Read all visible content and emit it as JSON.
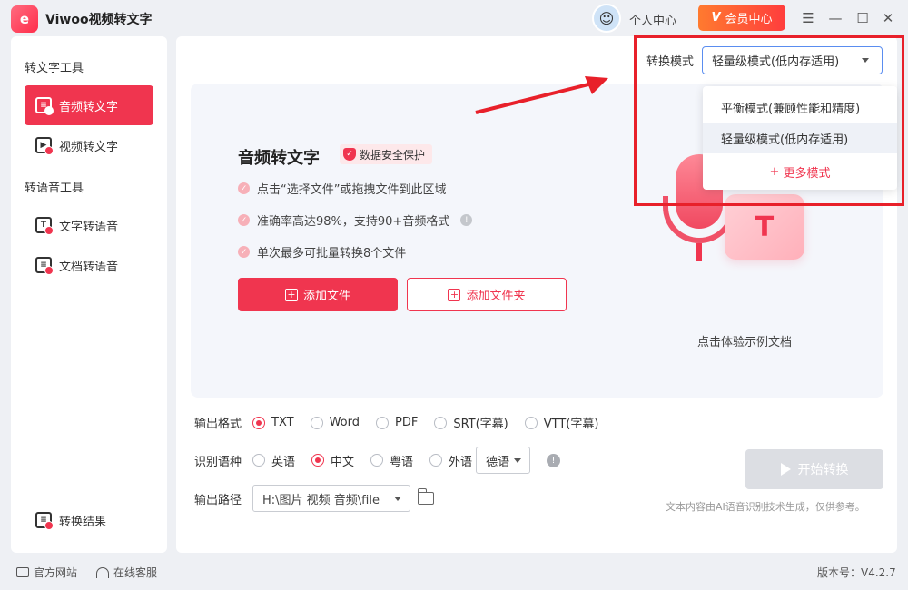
{
  "app": {
    "title": "Viwoo视频转文字",
    "logo_text": "e"
  },
  "header": {
    "user_center": "个人中心",
    "vip_label": "会员中心",
    "vip_mark": "V"
  },
  "sidebar": {
    "group1": "转文字工具",
    "items1": [
      {
        "label": "音频转文字",
        "icon": "audio-to-text-icon"
      },
      {
        "label": "视频转文字",
        "icon": "video-to-text-icon"
      }
    ],
    "group2": "转语音工具",
    "items2": [
      {
        "label": "文字转语音",
        "icon": "text-to-speech-icon"
      },
      {
        "label": "文档转语音",
        "icon": "doc-to-speech-icon"
      }
    ],
    "result": "转换结果"
  },
  "main": {
    "title": "音频转文字",
    "security_badge": "数据安全保护",
    "features": [
      "点击“选择文件”或拖拽文件到此区域",
      "准确率高达98%，支持90+音频格式",
      "单次最多可批量转换8个文件"
    ],
    "add_file": "添加文件",
    "add_folder": "添加文件夹",
    "sample": "点击体验示例文档",
    "card_letter": "T"
  },
  "mode": {
    "label": "转换模式",
    "selected": "轻量级模式(低内存适用)",
    "options": [
      "平衡模式(兼顾性能和精度)",
      "轻量级模式(低内存适用)"
    ],
    "more": "更多模式"
  },
  "output_format": {
    "label": "输出格式",
    "options": [
      "TXT",
      "Word",
      "PDF",
      "SRT(字幕)",
      "VTT(字幕)"
    ],
    "selected": "TXT"
  },
  "language": {
    "label": "识别语种",
    "options": [
      "英语",
      "中文",
      "粤语",
      "外语"
    ],
    "selected": "中文",
    "foreign_select": "德语"
  },
  "output_path": {
    "label": "输出路径",
    "value": "H:\\图片 视频 音频\\file"
  },
  "start_button": "开始转换",
  "disclaimer": "文本内容由AI语音识别技术生成，仅供参考。",
  "footer": {
    "website": "官方网站",
    "support": "在线客服",
    "version": "版本号：V4.2.7"
  },
  "colors": {
    "accent": "#f0354f",
    "highlight": "#e8202a",
    "vip": "#ff5a33"
  }
}
